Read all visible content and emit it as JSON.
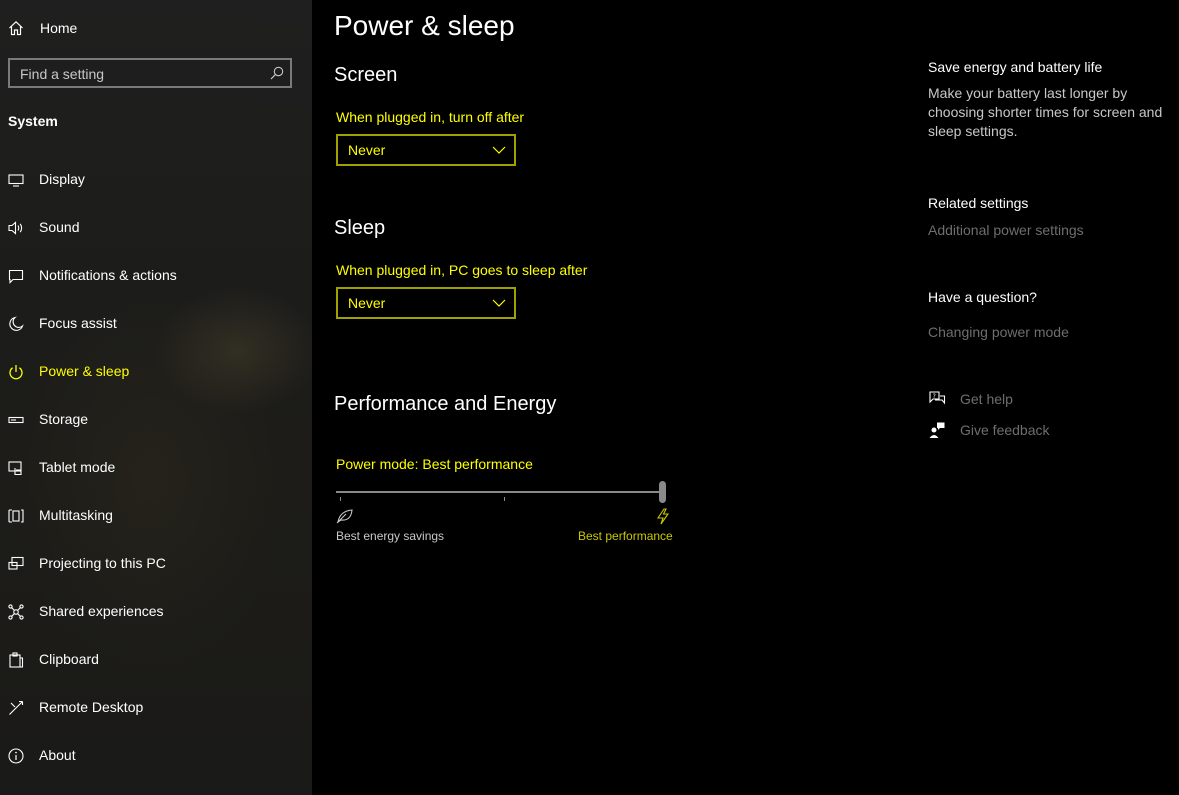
{
  "sidebar": {
    "home_label": "Home",
    "search_placeholder": "Find a setting",
    "group_label": "System",
    "items": [
      {
        "label": "Display",
        "icon": "display-icon",
        "active": false
      },
      {
        "label": "Sound",
        "icon": "speaker-icon",
        "active": false
      },
      {
        "label": "Notifications & actions",
        "icon": "notification-icon",
        "active": false
      },
      {
        "label": "Focus assist",
        "icon": "moon-icon",
        "active": false
      },
      {
        "label": "Power & sleep",
        "icon": "power-icon",
        "active": true
      },
      {
        "label": "Storage",
        "icon": "storage-icon",
        "active": false
      },
      {
        "label": "Tablet mode",
        "icon": "tablet-mode-icon",
        "active": false
      },
      {
        "label": "Multitasking",
        "icon": "multitasking-icon",
        "active": false
      },
      {
        "label": "Projecting to this PC",
        "icon": "projecting-icon",
        "active": false
      },
      {
        "label": "Shared experiences",
        "icon": "shared-experiences-icon",
        "active": false
      },
      {
        "label": "Clipboard",
        "icon": "clipboard-icon",
        "active": false
      },
      {
        "label": "Remote Desktop",
        "icon": "remote-desktop-icon",
        "active": false
      },
      {
        "label": "About",
        "icon": "info-icon",
        "active": false
      }
    ]
  },
  "main": {
    "title": "Power & sleep",
    "screen": {
      "heading": "Screen",
      "label": "When plugged in, turn off after",
      "value": "Never"
    },
    "sleep": {
      "heading": "Sleep",
      "label": "When plugged in, PC goes to sleep after",
      "value": "Never"
    },
    "performance": {
      "heading": "Performance and Energy",
      "mode_label": "Power mode: Best performance",
      "slider_value": 1.0,
      "left_caption": "Best energy savings",
      "right_caption": "Best performance"
    }
  },
  "aside": {
    "save_heading": "Save energy and battery life",
    "save_body": "Make your battery last longer by choosing shorter times for screen and sleep settings.",
    "related_heading": "Related settings",
    "related_link": "Additional power settings",
    "question_heading": "Have a question?",
    "question_link": "Changing power mode",
    "get_help": "Get help",
    "give_feedback": "Give feedback"
  },
  "colors": {
    "accent": "#ffff00",
    "link_disabled": "#6e6e6e",
    "background": "#000000"
  }
}
